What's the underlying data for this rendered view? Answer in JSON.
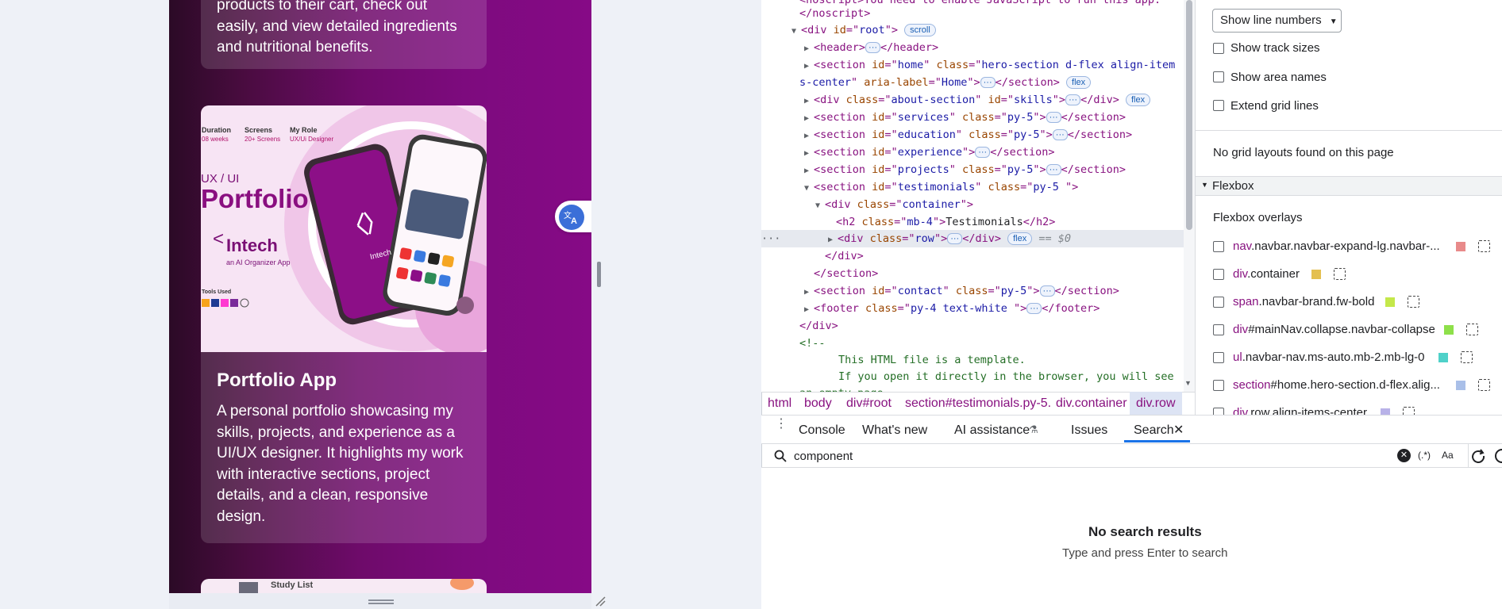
{
  "page": {
    "card_top_desc": [
      "products to their cart, check out",
      "easily, and view detailed ingredients",
      "and nutritional benefits."
    ],
    "portfolio_card": {
      "title": "Portfolio App",
      "desc": [
        "A personal portfolio showcasing my",
        "skills, projects, and experience as a",
        "UI/UX designer. It highlights my work",
        "with interactive sections, project",
        "details, and a clean, responsive",
        "design."
      ],
      "image": {
        "duration_label": "Duration",
        "duration_value": "08 weeks",
        "screens_label": "Screens",
        "screens_value": "20+ Screens",
        "role_label": "My Role",
        "role_value": "UX/Ui Designer",
        "uxui": "UX / UI",
        "portfolio": "Portfolio",
        "brand": "Intech",
        "brand_sub": "an AI Organizer App",
        "tools_label": "Tools Used",
        "phone_brand": "Intech"
      }
    },
    "next_card_label": "Study List",
    "translate_icon": "translate-icon"
  },
  "elements": {
    "lines": [
      {
        "t": "<noscript>You need to enable JavaScript to run this app.",
        "k": "raw"
      },
      {
        "t": "</noscript>",
        "k": "raw"
      }
    ],
    "root_id": "root",
    "scroll_badge": "scroll",
    "flex_badge": "flex",
    "dollar0": "== $0",
    "testimonials_heading": "Testimonials",
    "comment": [
      "<!--",
      "This HTML file is a template.",
      "If you open it directly in the browser, you will see",
      "an empty page."
    ]
  },
  "breadcrumbs": [
    "html",
    "body",
    "div#root",
    "section#testimonials.py-5.",
    "div.container",
    "div.row"
  ],
  "sidebar": {
    "line_numbers_select": "Show line numbers",
    "checkboxes": [
      "Show track sizes",
      "Show area names",
      "Extend grid lines"
    ],
    "no_grid": "No grid layouts found on this page",
    "flexbox_header": "Flexbox",
    "flexbox_overlays": "Flexbox overlays",
    "overlays": [
      {
        "tag": "nav",
        "cls": ".navbar.navbar-expand-lg.navbar-...",
        "color": "#e88a8a"
      },
      {
        "tag": "div",
        "cls": ".container",
        "color": "#e4c051"
      },
      {
        "tag": "span",
        "cls": ".navbar-brand.fw-bold",
        "color": "#c4e84a"
      },
      {
        "tag": "div",
        "cls": "#mainNav.collapse.navbar-collapse",
        "color": "#8ee04a"
      },
      {
        "tag": "ul",
        "cls": ".navbar-nav.ms-auto.mb-2.mb-lg-0",
        "color": "#4fd1c9"
      },
      {
        "tag": "section",
        "cls": "#home.hero-section.d-flex.alig...",
        "color": "#a9bfe8"
      },
      {
        "tag": "div",
        "cls": ".row.align-items-center",
        "color": "#b8b2e8"
      }
    ]
  },
  "drawer": {
    "tabs": [
      "Console",
      "What's new",
      "AI assistance",
      "Issues",
      "Search"
    ],
    "search_value": "component",
    "regex_label": "(.*)",
    "case_label": "Aa",
    "no_results": "No search results",
    "hint": "Type and press Enter to search"
  }
}
